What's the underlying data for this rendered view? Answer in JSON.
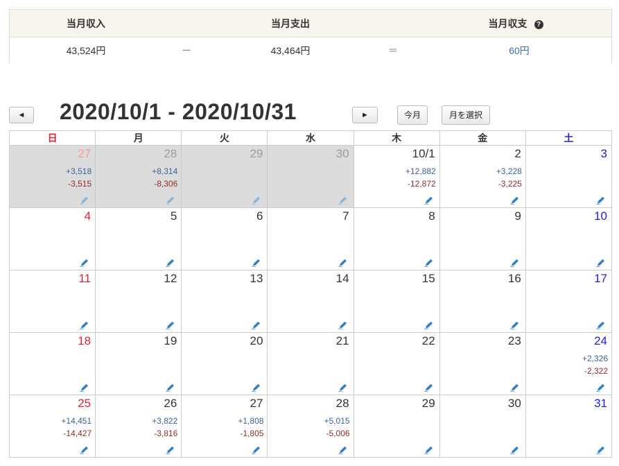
{
  "summary": {
    "income_label": "当月収入",
    "expense_label": "当月支出",
    "balance_label": "当月収支",
    "help_icon": "?",
    "income_value": "43,524円",
    "minus_sign": "ー",
    "expense_value": "43,464円",
    "equals_sign": "＝",
    "balance_value": "60円"
  },
  "nav": {
    "prev_label": "◄",
    "next_label": "►",
    "range_title": "2020/10/1 - 2020/10/31",
    "today_label": "今月",
    "select_month_label": "月を選択"
  },
  "calendar": {
    "weekdays": [
      "日",
      "月",
      "火",
      "水",
      "木",
      "金",
      "土"
    ],
    "weeks": [
      [
        {
          "day": "27",
          "inc": "+3,518",
          "exp": "-3,515",
          "other": true
        },
        {
          "day": "28",
          "inc": "+8,314",
          "exp": "-8,306",
          "other": true
        },
        {
          "day": "29",
          "inc": "",
          "exp": "",
          "other": true
        },
        {
          "day": "30",
          "inc": "",
          "exp": "",
          "other": true
        },
        {
          "day": "10/1",
          "inc": "+12,882",
          "exp": "-12,872",
          "other": false
        },
        {
          "day": "2",
          "inc": "+3,228",
          "exp": "-3,225",
          "other": false
        },
        {
          "day": "3",
          "inc": "",
          "exp": "",
          "other": false
        }
      ],
      [
        {
          "day": "4",
          "inc": "",
          "exp": "",
          "other": false
        },
        {
          "day": "5",
          "inc": "",
          "exp": "",
          "other": false
        },
        {
          "day": "6",
          "inc": "",
          "exp": "",
          "other": false
        },
        {
          "day": "7",
          "inc": "",
          "exp": "",
          "other": false
        },
        {
          "day": "8",
          "inc": "",
          "exp": "",
          "other": false
        },
        {
          "day": "9",
          "inc": "",
          "exp": "",
          "other": false
        },
        {
          "day": "10",
          "inc": "",
          "exp": "",
          "other": false
        }
      ],
      [
        {
          "day": "11",
          "inc": "",
          "exp": "",
          "other": false
        },
        {
          "day": "12",
          "inc": "",
          "exp": "",
          "other": false
        },
        {
          "day": "13",
          "inc": "",
          "exp": "",
          "other": false
        },
        {
          "day": "14",
          "inc": "",
          "exp": "",
          "other": false
        },
        {
          "day": "15",
          "inc": "",
          "exp": "",
          "other": false
        },
        {
          "day": "16",
          "inc": "",
          "exp": "",
          "other": false
        },
        {
          "day": "17",
          "inc": "",
          "exp": "",
          "other": false
        }
      ],
      [
        {
          "day": "18",
          "inc": "",
          "exp": "",
          "other": false
        },
        {
          "day": "19",
          "inc": "",
          "exp": "",
          "other": false
        },
        {
          "day": "20",
          "inc": "",
          "exp": "",
          "other": false
        },
        {
          "day": "21",
          "inc": "",
          "exp": "",
          "other": false
        },
        {
          "day": "22",
          "inc": "",
          "exp": "",
          "other": false
        },
        {
          "day": "23",
          "inc": "",
          "exp": "",
          "other": false
        },
        {
          "day": "24",
          "inc": "+2,326",
          "exp": "-2,322",
          "other": false
        }
      ],
      [
        {
          "day": "25",
          "inc": "+14,451",
          "exp": "-14,427",
          "other": false
        },
        {
          "day": "26",
          "inc": "+3,822",
          "exp": "-3,816",
          "other": false
        },
        {
          "day": "27",
          "inc": "+1,808",
          "exp": "-1,805",
          "other": false
        },
        {
          "day": "28",
          "inc": "+5,015",
          "exp": "-5,006",
          "other": false
        },
        {
          "day": "29",
          "inc": "",
          "exp": "",
          "other": false
        },
        {
          "day": "30",
          "inc": "",
          "exp": "",
          "other": false
        },
        {
          "day": "31",
          "inc": "",
          "exp": "",
          "other": false
        }
      ]
    ],
    "edit_icon": "pencil-icon"
  },
  "colors": {
    "sunday": "#e0202f",
    "saturday": "#1f1fe0",
    "income": "#3b5f98",
    "expense": "#8f2a2a",
    "balance": "#3b6fb0",
    "other_month_bg": "#dcdcdc",
    "pencil": "#2f80c9"
  }
}
